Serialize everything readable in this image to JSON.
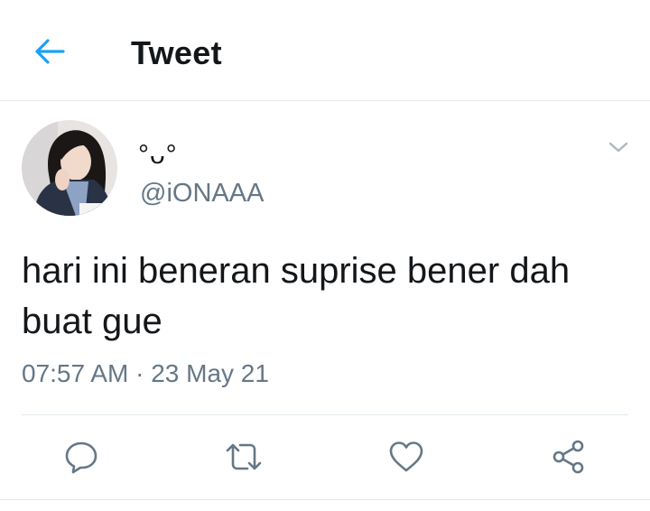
{
  "header": {
    "back_icon": "back-arrow-icon",
    "title": "Tweet"
  },
  "tweet": {
    "display_name": "°ᴗ°",
    "handle": "@iONAAA",
    "text": "hari ini beneran suprise bener dah buat gue",
    "time": "07:57 AM",
    "separator": " · ",
    "date": "23 May 21",
    "caret_icon": "chevron-down-icon"
  },
  "actions": [
    {
      "icon": "reply-icon"
    },
    {
      "icon": "retweet-icon"
    },
    {
      "icon": "like-icon"
    },
    {
      "icon": "share-icon"
    }
  ],
  "colors": {
    "accent": "#1da1f2",
    "text": "#14171a",
    "secondary": "#657786",
    "divider": "#e1e8ed"
  }
}
